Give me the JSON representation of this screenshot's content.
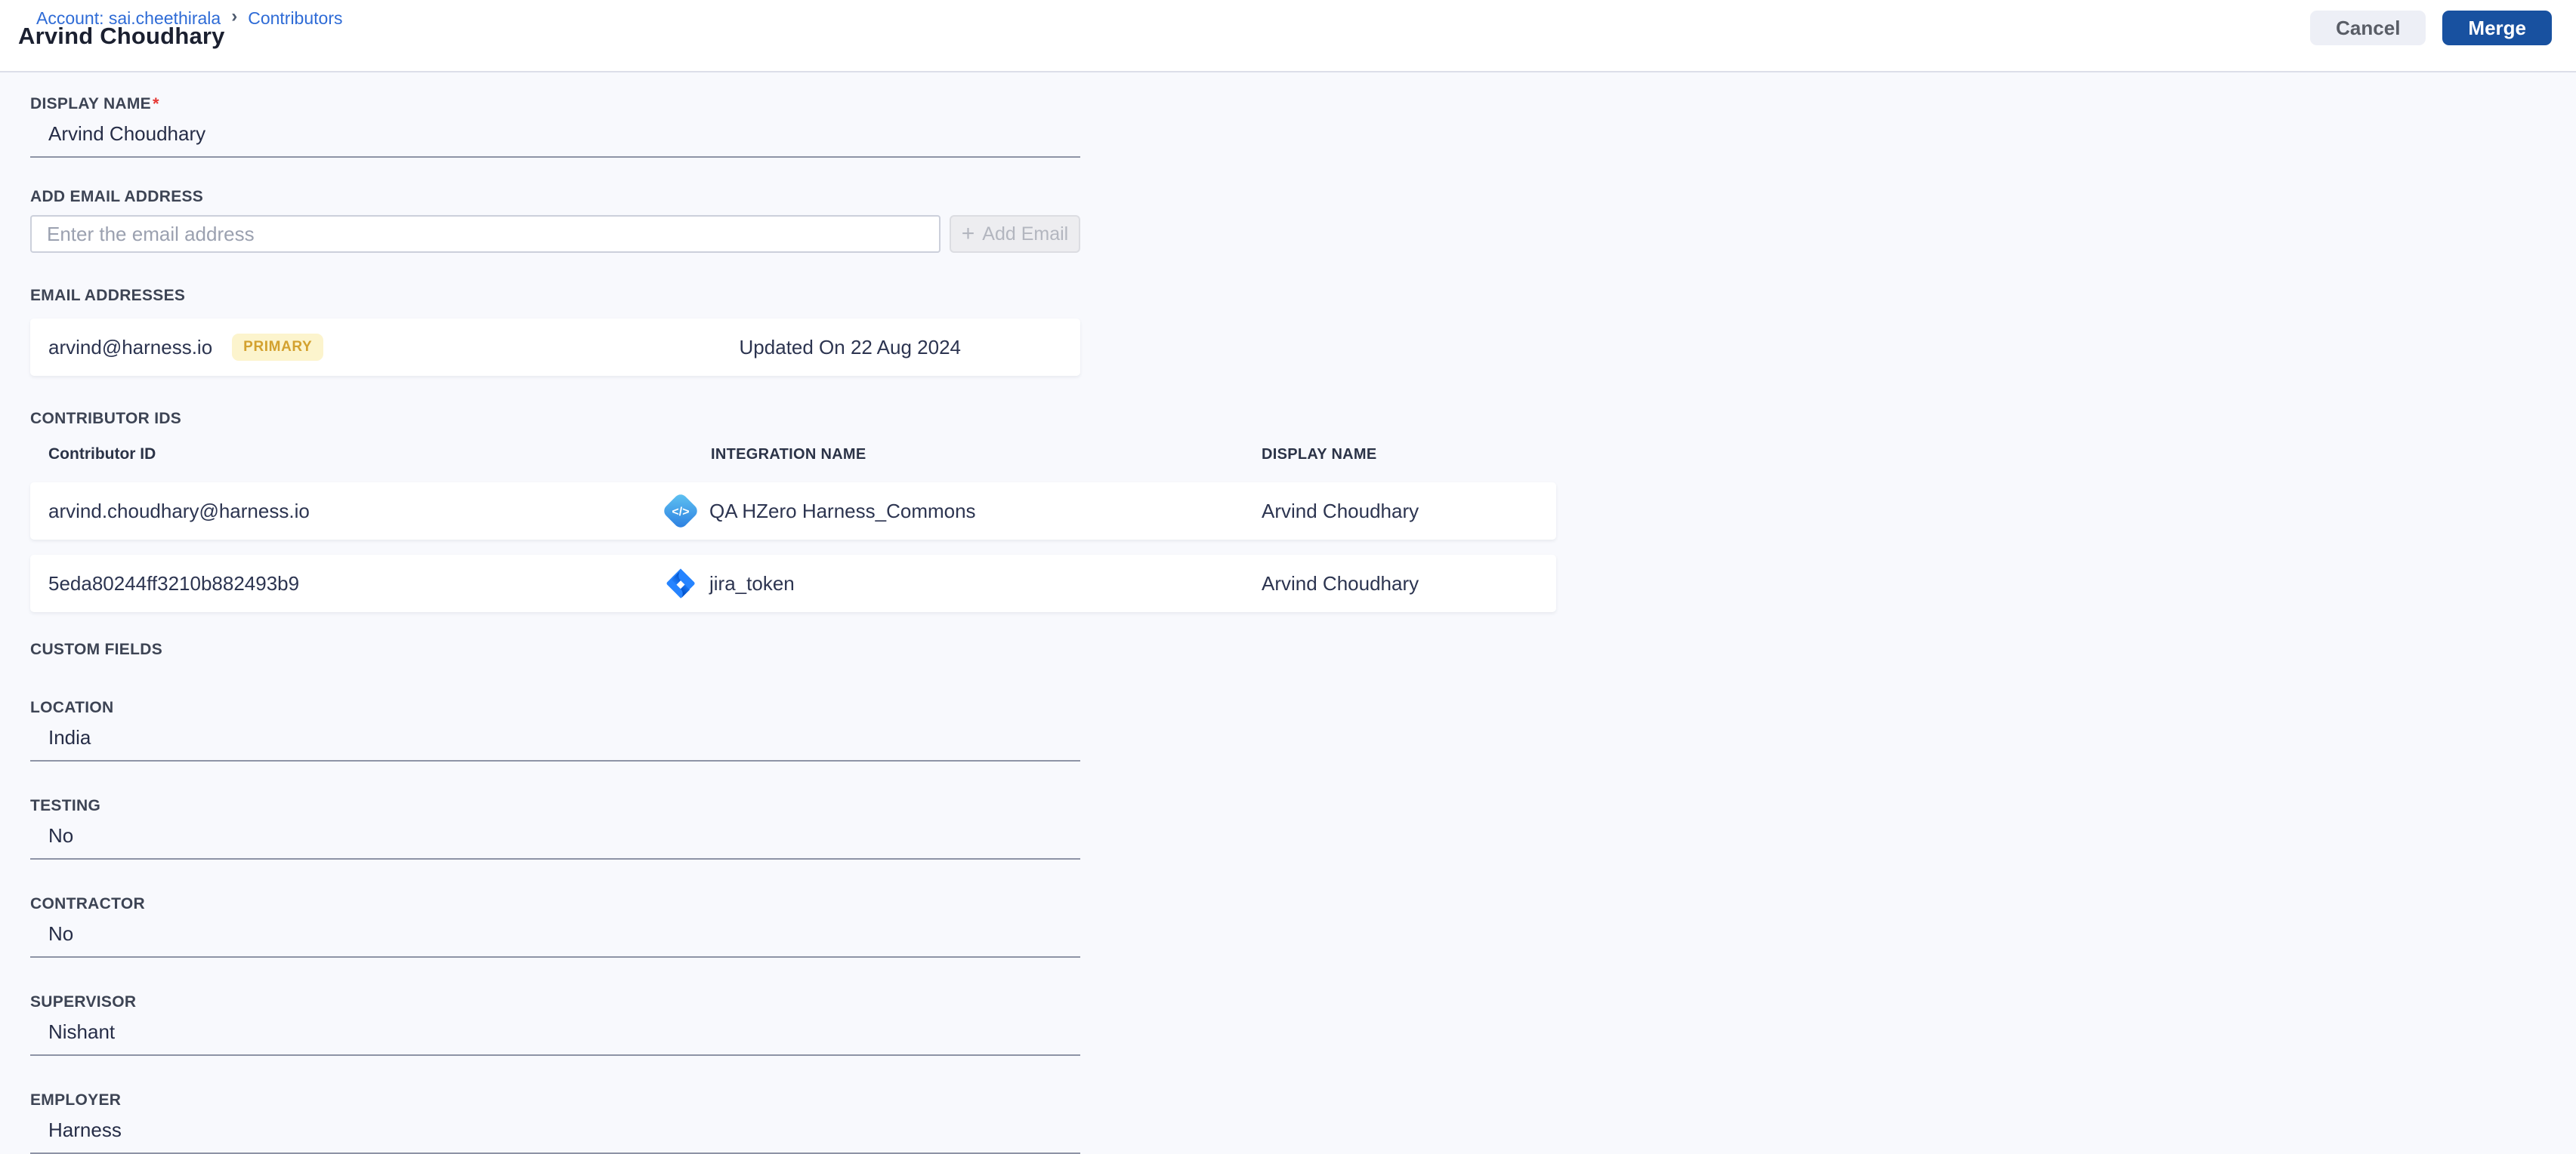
{
  "breadcrumb": {
    "account_link": "Account: sai.cheethirala",
    "separator": "›",
    "current": "Contributors"
  },
  "header": {
    "title": "Arvind Choudhary",
    "cancel_label": "Cancel",
    "merge_label": "Merge"
  },
  "display_name": {
    "label": "DISPLAY NAME",
    "required_marker": "*",
    "value": "Arvind Choudhary"
  },
  "add_email": {
    "label": "ADD EMAIL ADDRESS",
    "placeholder": "Enter the email address",
    "plus_glyph": "+",
    "button_label": "Add Email"
  },
  "email_addresses": {
    "label": "EMAIL ADDRESSES",
    "items": [
      {
        "email": "arvind@harness.io",
        "badge": "PRIMARY",
        "updated": "Updated On 22 Aug 2024"
      }
    ]
  },
  "contributor_ids": {
    "label": "CONTRIBUTOR IDS",
    "columns": {
      "id": "Contributor ID",
      "integration": "INTEGRATION NAME",
      "display_name": "DISPLAY NAME"
    },
    "rows": [
      {
        "id": "arvind.choudhary@harness.io",
        "integration": "QA HZero Harness_Commons",
        "icon": "code-integration-icon",
        "display_name": "Arvind Choudhary"
      },
      {
        "id": "5eda80244ff3210b882493b9",
        "integration": "jira_token",
        "icon": "jira-icon",
        "display_name": "Arvind Choudhary"
      }
    ]
  },
  "custom_fields": {
    "label": "CUSTOM FIELDS",
    "fields": [
      {
        "label": "LOCATION",
        "value": "India"
      },
      {
        "label": "TESTING",
        "value": "No"
      },
      {
        "label": "CONTRACTOR",
        "value": "No"
      },
      {
        "label": "SUPERVISOR",
        "value": "Nishant"
      },
      {
        "label": "EMPLOYER",
        "value": "Harness"
      }
    ]
  },
  "colors": {
    "merge_button": "#1851a0",
    "link_blue": "#2e6bd6",
    "badge_bg": "#fcf4cd",
    "badge_text": "#d3a12f",
    "page_bg": "#f8f9fd",
    "required_red": "#e53935"
  }
}
